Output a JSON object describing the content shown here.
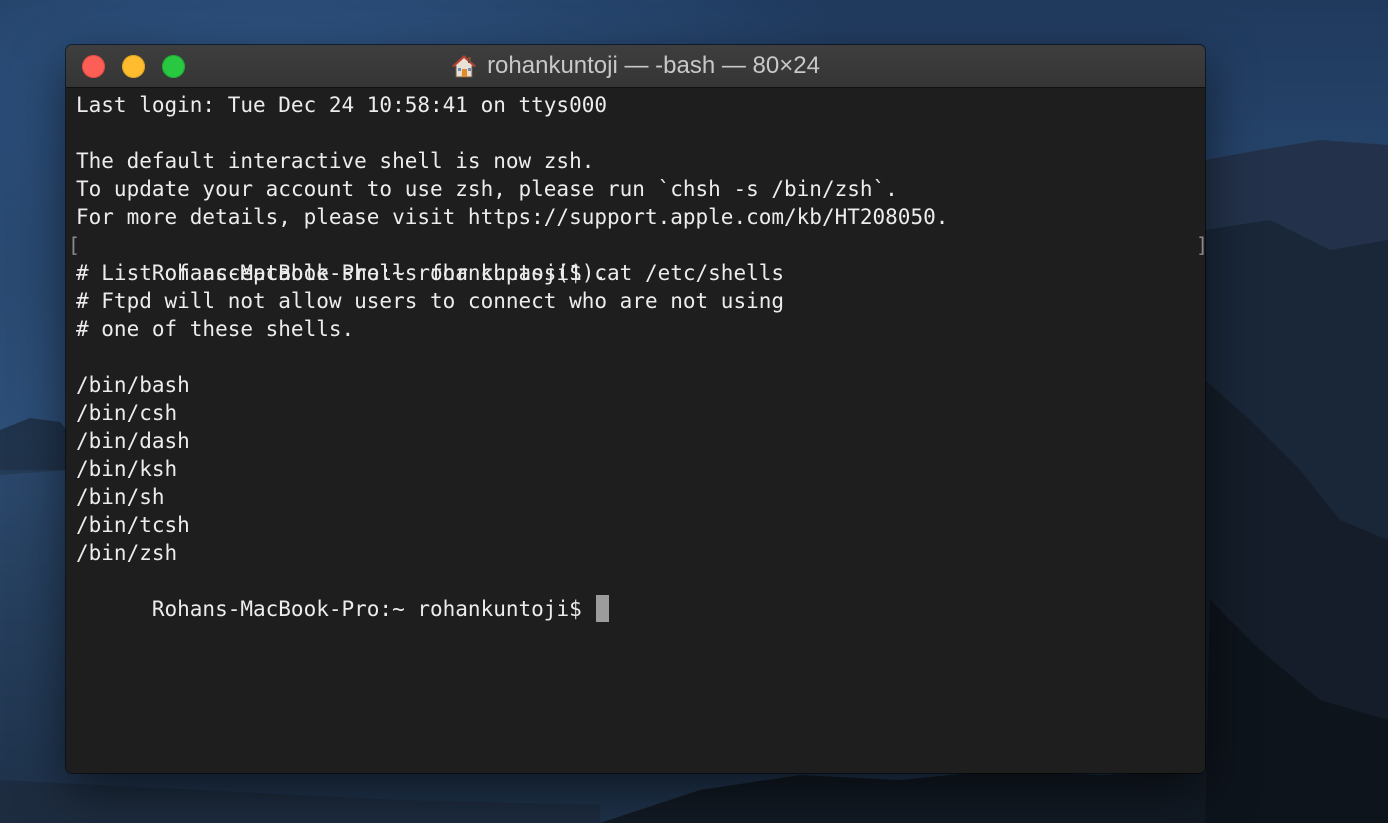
{
  "window": {
    "title": "rohankuntoji — -bash — 80×24",
    "title_icon": "home-icon"
  },
  "terminal": {
    "lines": [
      "Last login: Tue Dec 24 10:58:41 on ttys000",
      "",
      "The default interactive shell is now zsh.",
      "To update your account to use zsh, please run `chsh -s /bin/zsh`.",
      "For more details, please visit https://support.apple.com/kb/HT208050.",
      "Rohans-MacBook-Pro:~ rohankuntoji$ cat /etc/shells",
      "# List of acceptable shells for chpass(1).",
      "# Ftpd will not allow users to connect who are not using",
      "# one of these shells.",
      "",
      "/bin/bash",
      "/bin/csh",
      "/bin/dash",
      "/bin/ksh",
      "/bin/sh",
      "/bin/tcsh",
      "/bin/zsh"
    ],
    "prompt": "Rohans-MacBook-Pro:~ rohankuntoji$ ",
    "marked_line_bracket_left": "[",
    "marked_line_bracket_right": "]"
  },
  "colors": {
    "close": "#fd5f57",
    "minimize": "#febc2e",
    "zoom": "#28c840",
    "terminal_bg": "#1e1e1e",
    "terminal_text": "#ececec",
    "cursor": "#9c9c9c"
  }
}
